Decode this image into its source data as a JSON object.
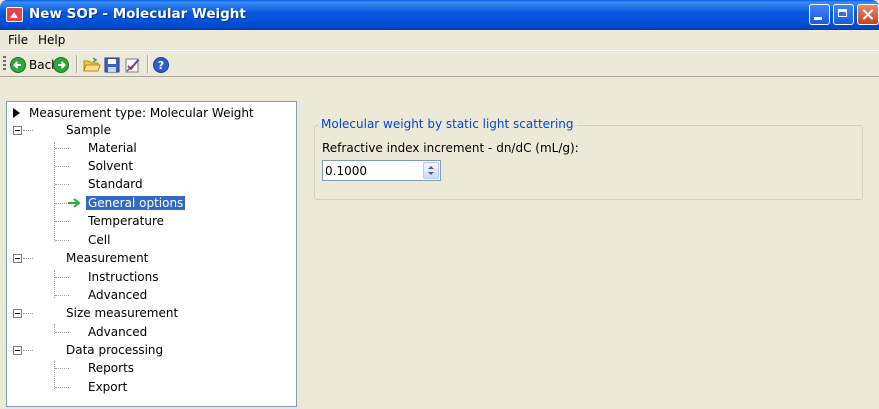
{
  "window": {
    "title": "New SOP - Molecular Weight"
  },
  "menu": {
    "file": "File",
    "help": "Help"
  },
  "toolbar": {
    "back_label": "Back",
    "icons": [
      "back-icon",
      "forward-icon",
      "open-folder-icon",
      "save-icon",
      "edit-check-icon",
      "help-icon"
    ]
  },
  "tree": {
    "items": [
      {
        "label": "Measurement type: Molecular Weight"
      },
      {
        "label": "Sample"
      },
      {
        "label": "Material"
      },
      {
        "label": "Solvent"
      },
      {
        "label": "Standard"
      },
      {
        "label": "General options"
      },
      {
        "label": "Temperature"
      },
      {
        "label": "Cell"
      },
      {
        "label": "Measurement"
      },
      {
        "label": "Instructions"
      },
      {
        "label": "Advanced"
      },
      {
        "label": "Size measurement"
      },
      {
        "label": "Advanced"
      },
      {
        "label": "Data processing"
      },
      {
        "label": "Reports"
      },
      {
        "label": "Export"
      }
    ]
  },
  "panel": {
    "group_title": "Molecular weight by static light scattering",
    "field_label": "Refractive index increment - dn/dC (mL/g):",
    "field_value": "0.1000"
  },
  "colors": {
    "title_bar": "#0054e3",
    "selection": "#316ac5",
    "group_title": "#0046d5",
    "face": "#ece9d8"
  }
}
